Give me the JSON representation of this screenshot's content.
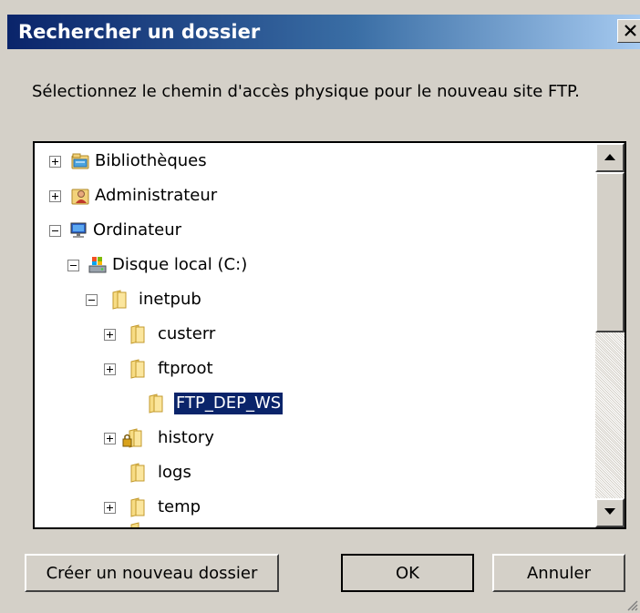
{
  "dialog": {
    "title": "Rechercher un dossier",
    "close_icon": "close-icon",
    "instruction": "Sélectionnez le chemin d'accès physique pour le nouveau site FTP."
  },
  "tree": {
    "items": [
      {
        "label": "Bibliothèques",
        "icon": "libraries-icon",
        "expander": "plus"
      },
      {
        "label": "Administrateur",
        "icon": "user-folder-icon",
        "expander": "plus"
      },
      {
        "label": "Ordinateur",
        "icon": "computer-icon",
        "expander": "minus"
      },
      {
        "label": "Disque local (C:)",
        "icon": "local-disk-icon",
        "expander": "minus"
      },
      {
        "label": "inetpub",
        "icon": "folder-icon",
        "expander": "minus"
      },
      {
        "label": "custerr",
        "icon": "folder-icon",
        "expander": "plus"
      },
      {
        "label": "ftproot",
        "icon": "folder-icon",
        "expander": "plus"
      },
      {
        "label": "FTP_DEP_WS",
        "icon": "folder-icon",
        "expander": "none",
        "selected": true
      },
      {
        "label": "history",
        "icon": "locked-folder-icon",
        "expander": "plus"
      },
      {
        "label": "logs",
        "icon": "folder-icon",
        "expander": "none"
      },
      {
        "label": "temp",
        "icon": "folder-icon",
        "expander": "plus"
      }
    ]
  },
  "buttons": {
    "new_folder": "Créer un nouveau dossier",
    "ok": "OK",
    "cancel": "Annuler"
  },
  "colors": {
    "title_gradient_start": "#0a246a",
    "title_gradient_end": "#a6caf0",
    "dialog_face": "#d4d0c8",
    "selection": "#0a246a"
  }
}
